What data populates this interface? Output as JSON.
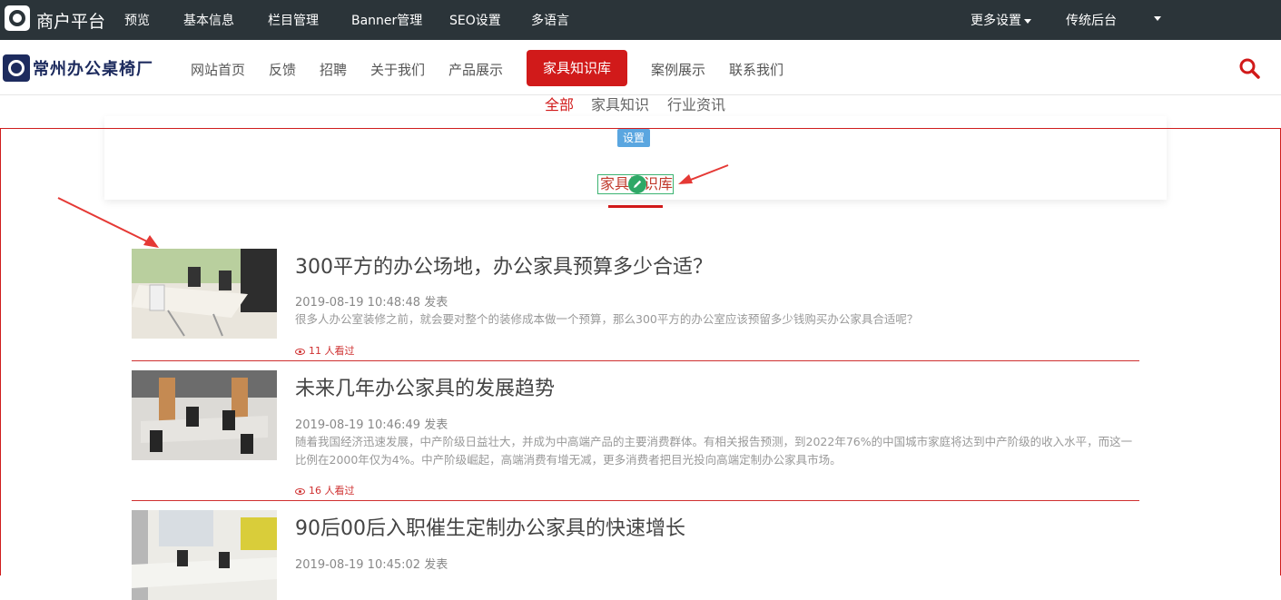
{
  "topbar": {
    "title": "商户平台",
    "items": [
      "预览",
      "基本信息",
      "栏目管理",
      "Banner管理",
      "SEO设置",
      "多语言"
    ],
    "more_settings": "更多设置",
    "legacy_admin": "传统后台",
    "background": "#2b3439"
  },
  "navbar": {
    "brand": "常州办公桌椅厂",
    "items": [
      "网站首页",
      "反馈",
      "招聘",
      "关于我们",
      "产品展示",
      "家具知识库",
      "案例展示",
      "联系我们"
    ],
    "active_item": "家具知识库",
    "accent": "#d11a1a",
    "search_icon": "search-icon"
  },
  "subtabs": {
    "items": [
      "全部",
      "家具知识",
      "行业资讯"
    ],
    "active": "全部"
  },
  "section": {
    "settings_badge": "设置",
    "title": "家具知识库",
    "edit_icon": "pencil-icon"
  },
  "articles": [
    {
      "title": "300平方的办公场地，办公家具预算多少合适？",
      "date": "2019-08-19 10:48:48 发表",
      "desc": "很多人办公室装修之前，就会要对整个的装修成本做一个预算，那么300平方的办公室应该预留多少钱购买办公家具合适呢？",
      "views": "11 人看过"
    },
    {
      "title": "未来几年办公家具的发展趋势",
      "date": "2019-08-19 10:46:49 发表",
      "desc": "随着我国经济迅速发展，中产阶级日益壮大，并成为中高端产品的主要消费群体。有相关报告预测，到2022年76%的中国城市家庭将达到中产阶级的收入水平，而这一比例在2000年仅为4%。中产阶级崛起，高端消费有增无减，更多消费者把目光投向高端定制办公家具市场。",
      "views": "16 人看过"
    },
    {
      "title": "90后00后入职催生定制办公家具的快速增长",
      "date": "2019-08-19 10:45:02 发表"
    }
  ]
}
